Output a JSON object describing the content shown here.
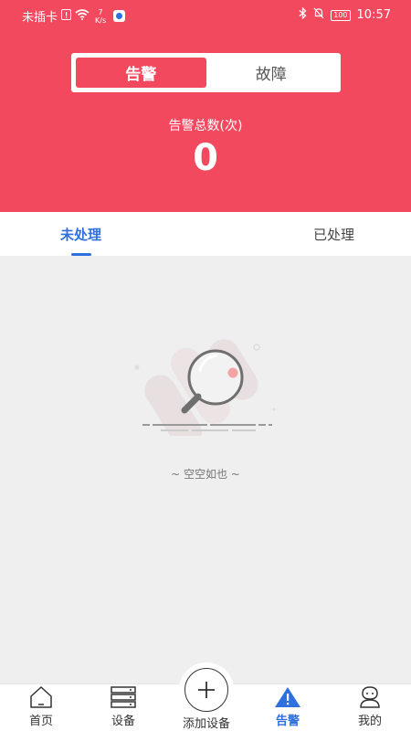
{
  "status_bar": {
    "carrier": "未插卡",
    "net_speed_value": "7",
    "net_speed_unit": "K/s",
    "battery": "100",
    "time": "10:57"
  },
  "segment": {
    "items": [
      {
        "label": "告警",
        "active": true
      },
      {
        "label": "故障",
        "active": false
      }
    ]
  },
  "summary": {
    "label": "告警总数(次)",
    "value": "0"
  },
  "tabs": [
    {
      "label": "未处理",
      "active": true
    },
    {
      "label": "已处理",
      "active": false
    }
  ],
  "empty_state": {
    "text": "~ 空空如也 ~",
    "icon": "magnifier-icon"
  },
  "bottom_nav": {
    "items": [
      {
        "label": "首页",
        "icon": "home-icon"
      },
      {
        "label": "设备",
        "icon": "device-icon"
      },
      {
        "label": "添加设备",
        "icon": "plus-icon"
      },
      {
        "label": "告警",
        "icon": "alarm-icon",
        "active": true
      },
      {
        "label": "我的",
        "icon": "profile-icon"
      }
    ]
  },
  "colors": {
    "brand_red": "#f2495f",
    "accent_blue": "#2f6fe0",
    "background": "#efefef"
  }
}
